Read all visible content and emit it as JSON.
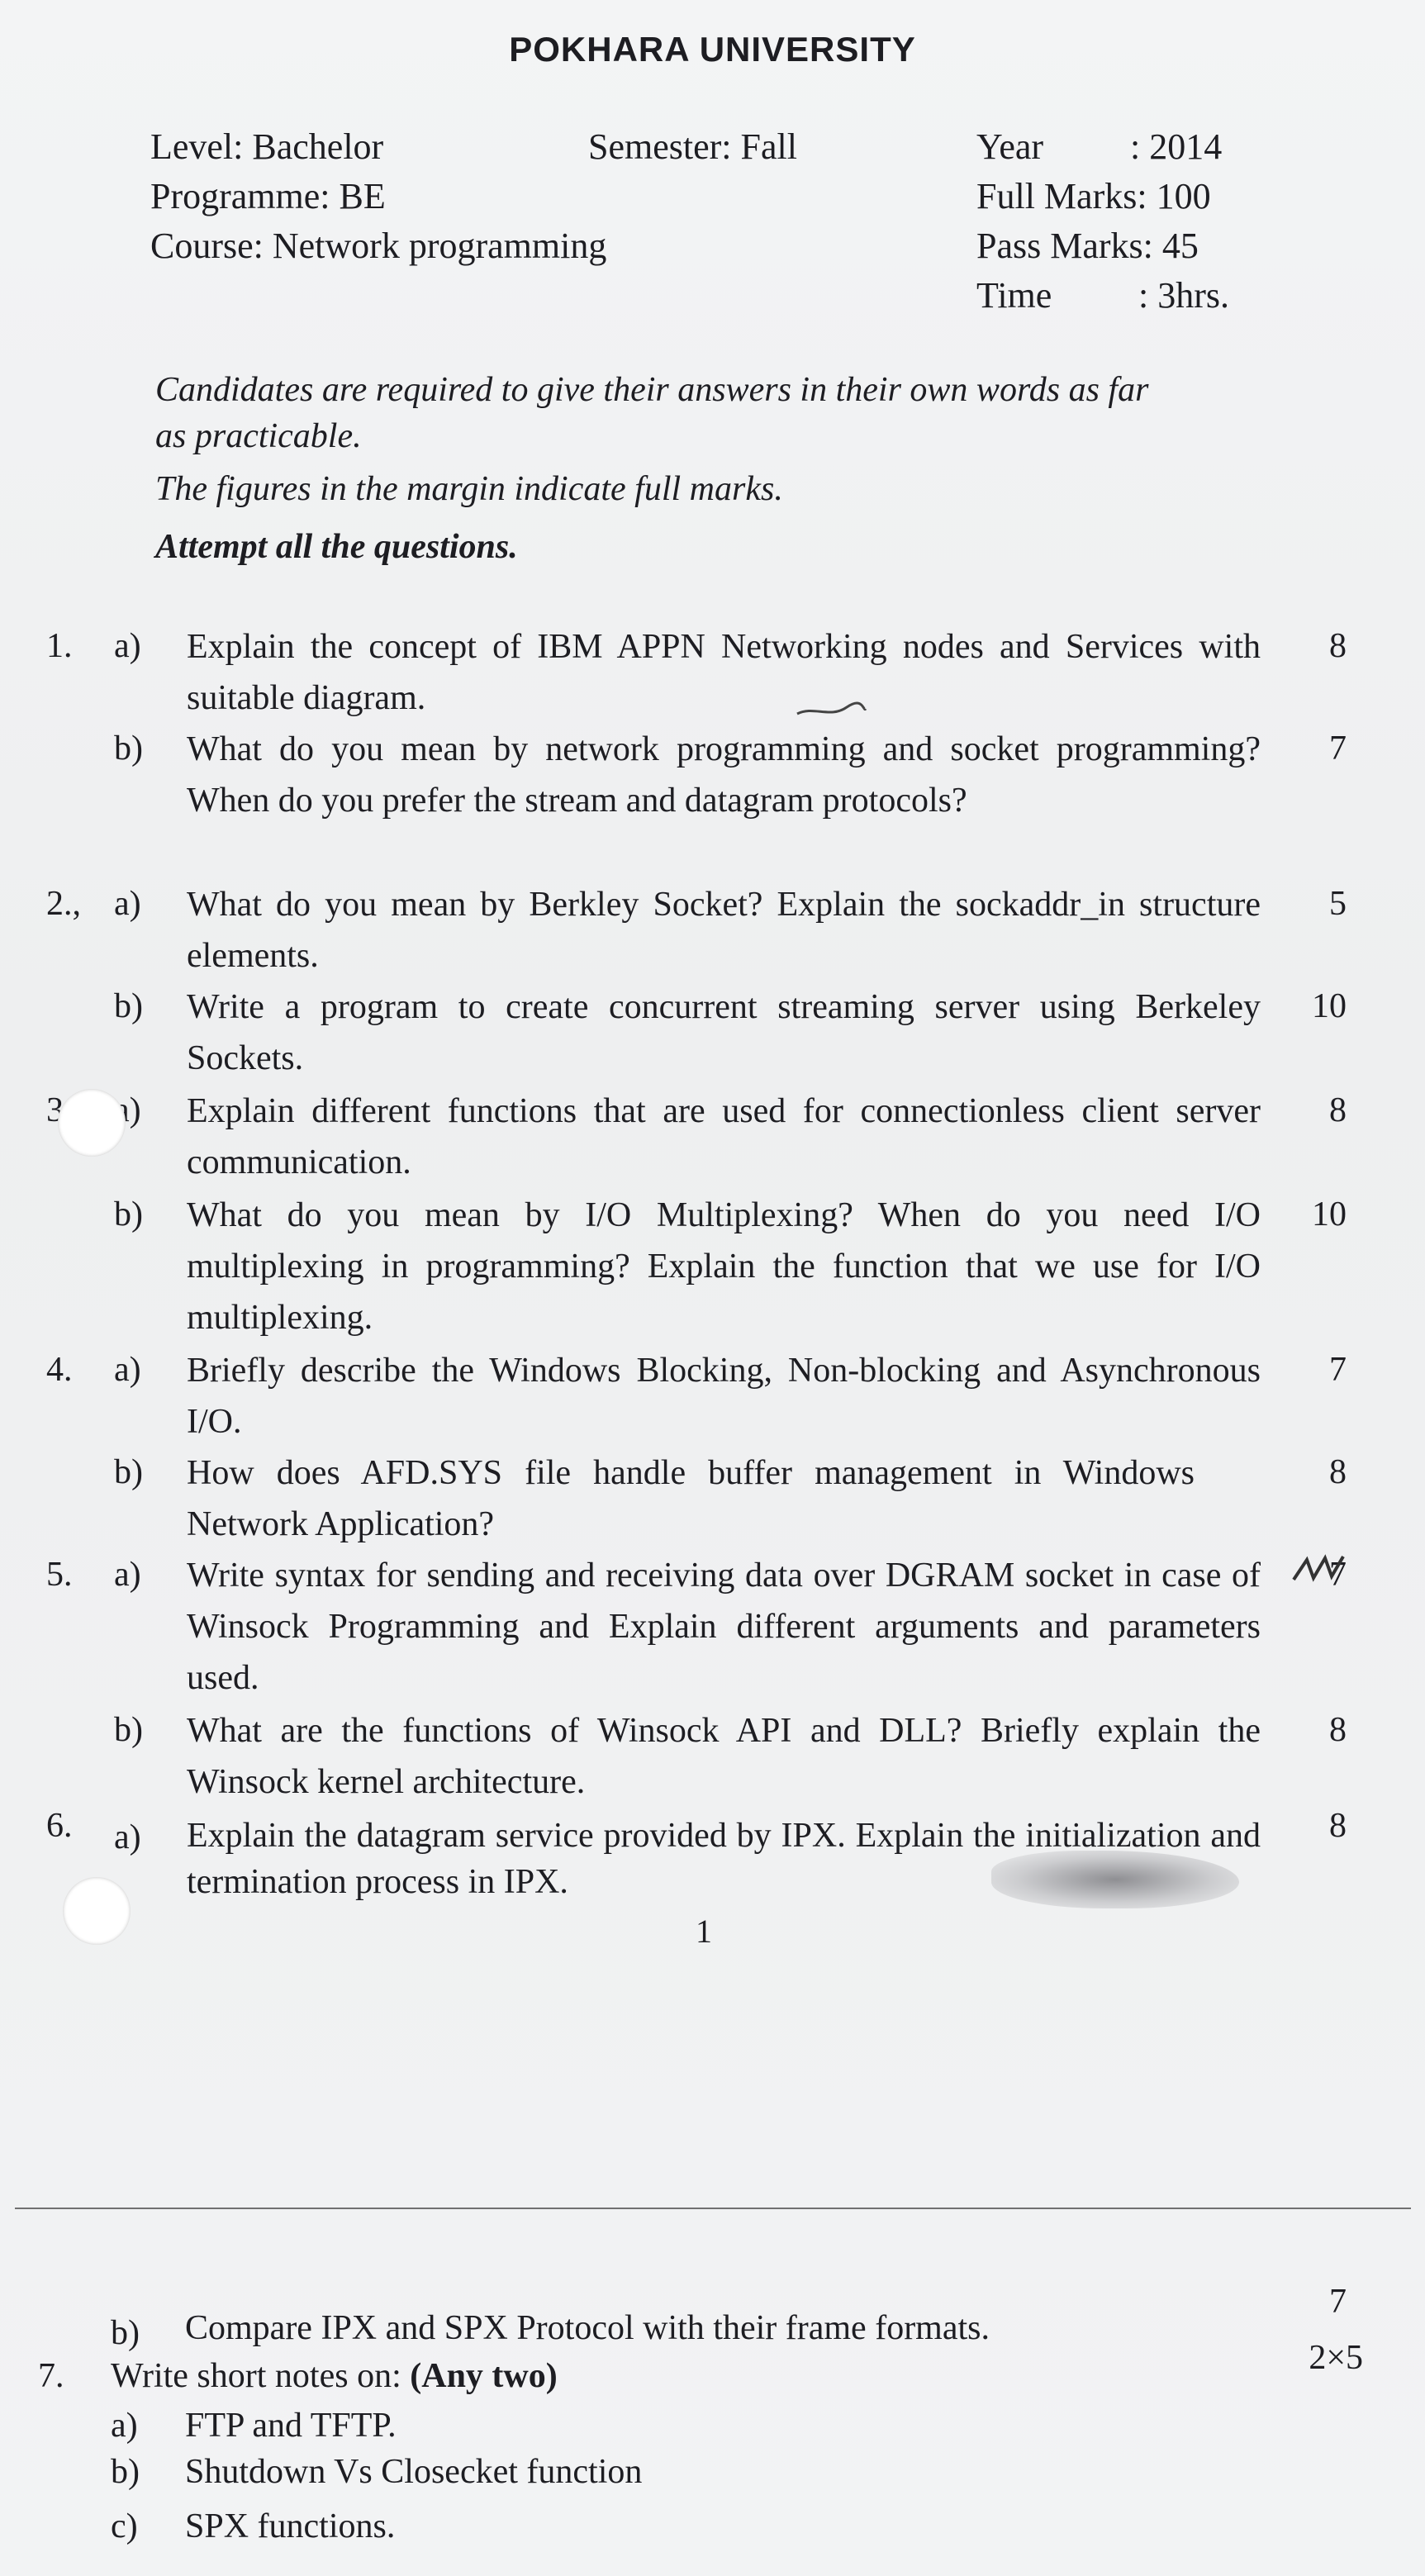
{
  "header": {
    "university": "POKHARA UNIVERSITY",
    "level": "Level:  Bachelor",
    "semester": "Semester: Fall",
    "programme": "Programme: BE",
    "course": "Course: Network programming",
    "year_label": "Year",
    "year_value": ": 2014",
    "full_marks": "Full Marks: 100",
    "pass_marks": "Pass Marks: 45",
    "time_label": "Time",
    "time_value": ":  3hrs."
  },
  "instructions": {
    "line1": "Candidates are required to give their answers in their own words as far",
    "line2": "as practicable.",
    "line3": "The figures in the margin indicate full marks.",
    "line4": "Attempt all the questions."
  },
  "questions": {
    "q1": {
      "num": "1.",
      "a_label": "a)",
      "a_text": "Explain the concept of IBM APPN Networking nodes and Services with suitable diagram.",
      "a_marks": "8",
      "b_label": "b)",
      "b_text": "What do you mean by network programming and socket programming? When do you prefer the stream and datagram protocols?",
      "b_marks": "7"
    },
    "q2": {
      "num": "2.,",
      "a_label": "a)",
      "a_text": "What do you mean by Berkley Socket? Explain the sockaddr_in structure elements.",
      "a_marks": "5",
      "b_label": "b)",
      "b_text": "Write a program to create concurrent streaming server using Berkeley Sockets.",
      "b_marks": "10"
    },
    "q3": {
      "num": "3",
      "a_label": "a)",
      "a_text": "Explain different functions that are used for connectionless client server communication.",
      "a_marks": "8",
      "b_label": "b)",
      "b_text": "What do you mean by I/O Multiplexing? When do you need I/O multiplexing in programming? Explain the function that we use for I/O multiplexing.",
      "b_marks": "10"
    },
    "q4": {
      "num": "4.",
      "a_label": "a)",
      "a_text": "Briefly describe the Windows Blocking, Non-blocking and Asynchronous I/O.",
      "a_marks": "7",
      "b_label": "b)",
      "b_text": "How does AFD.SYS file handle buffer management in Windows Network Application?",
      "b_marks": "8"
    },
    "q5": {
      "num": "5.",
      "a_label": "a)",
      "a_text": "Write syntax for sending and receiving data over DGRAM socket in case of Winsock Programming and Explain different arguments and parameters used.",
      "a_marks": "7",
      "b_label": "b)",
      "b_text": "What are the functions of Winsock API and DLL? Briefly explain the Winsock kernel architecture.",
      "b_marks": "8"
    },
    "q6": {
      "num": "6.",
      "a_label": "a)",
      "a_text": "Explain the datagram service provided by IPX. Explain the initialization and termination process in IPX.",
      "a_marks": "8",
      "b_label": "b)",
      "b_text": "Compare IPX and SPX Protocol with their frame formats.",
      "b_marks": "7"
    },
    "q7": {
      "num": "7.",
      "text_plain": "Write short notes on: ",
      "text_bold": "(Any two)",
      "marks": "2×5",
      "a_label": "a)",
      "a_text": "FTP and TFTP.",
      "b_label": "b)",
      "b_text": "Shutdown Vs Closecket function",
      "c_label": "c)",
      "c_text": "SPX functions."
    }
  },
  "page_number": "1"
}
